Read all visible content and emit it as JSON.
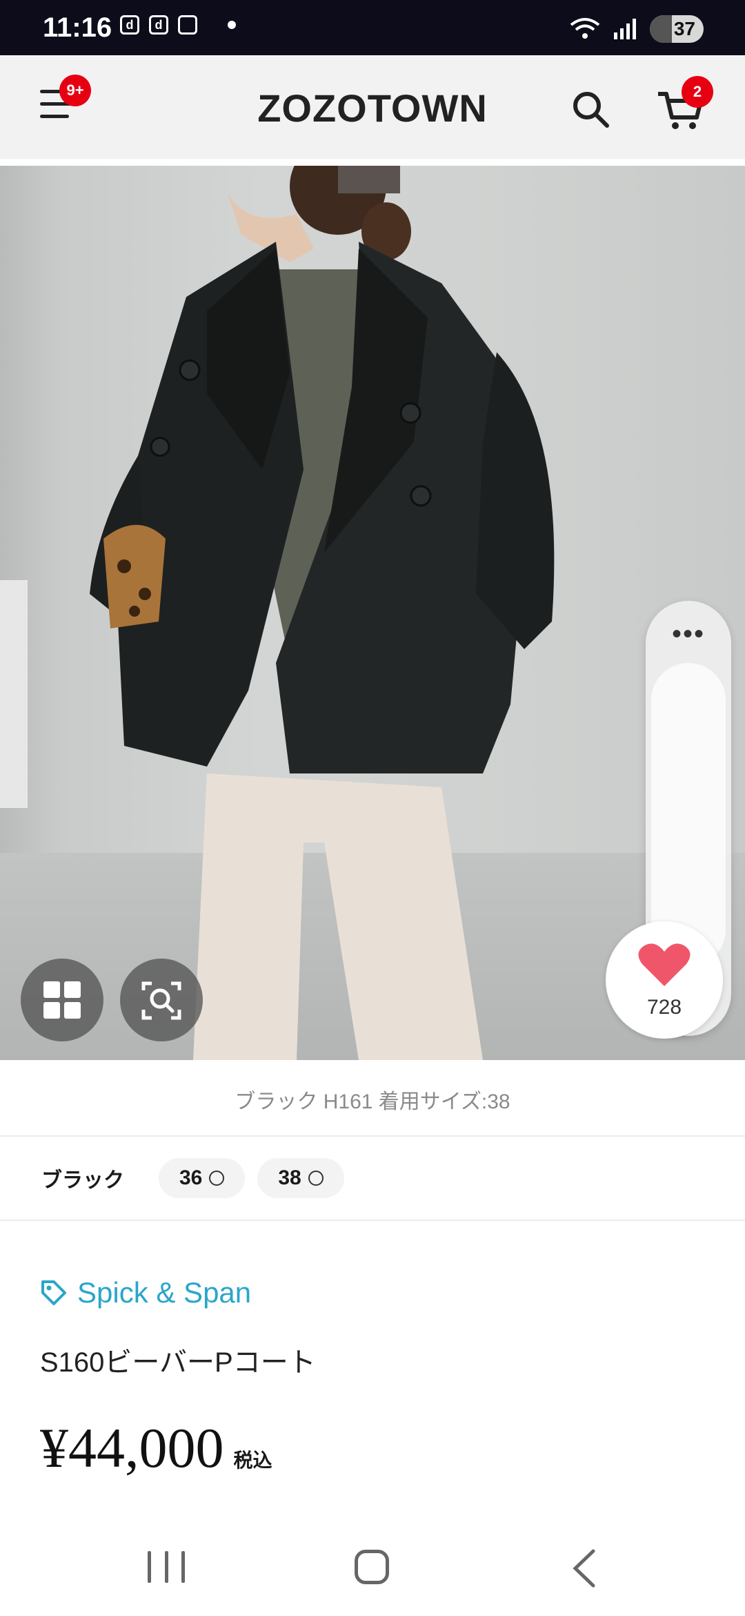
{
  "status_bar": {
    "time": "11:16",
    "left_icons": [
      "d",
      "d"
    ],
    "battery": "37"
  },
  "header": {
    "logo": "ZOZOTOWN",
    "menu_badge": "9+",
    "cart_badge": "2"
  },
  "hero": {
    "favorite_count": "728",
    "accent_color": "#f0566a"
  },
  "caption": "ブラック H161 着用サイズ:38",
  "variants": {
    "color": "ブラック",
    "sizes": [
      "36",
      "38"
    ]
  },
  "product": {
    "brand": "Spick & Span",
    "name": "S160ビーバーPコート",
    "price": "¥44,000",
    "tax_label": "税込"
  },
  "colors": {
    "brand_link": "#2aa6c9",
    "badge": "#e60012"
  }
}
